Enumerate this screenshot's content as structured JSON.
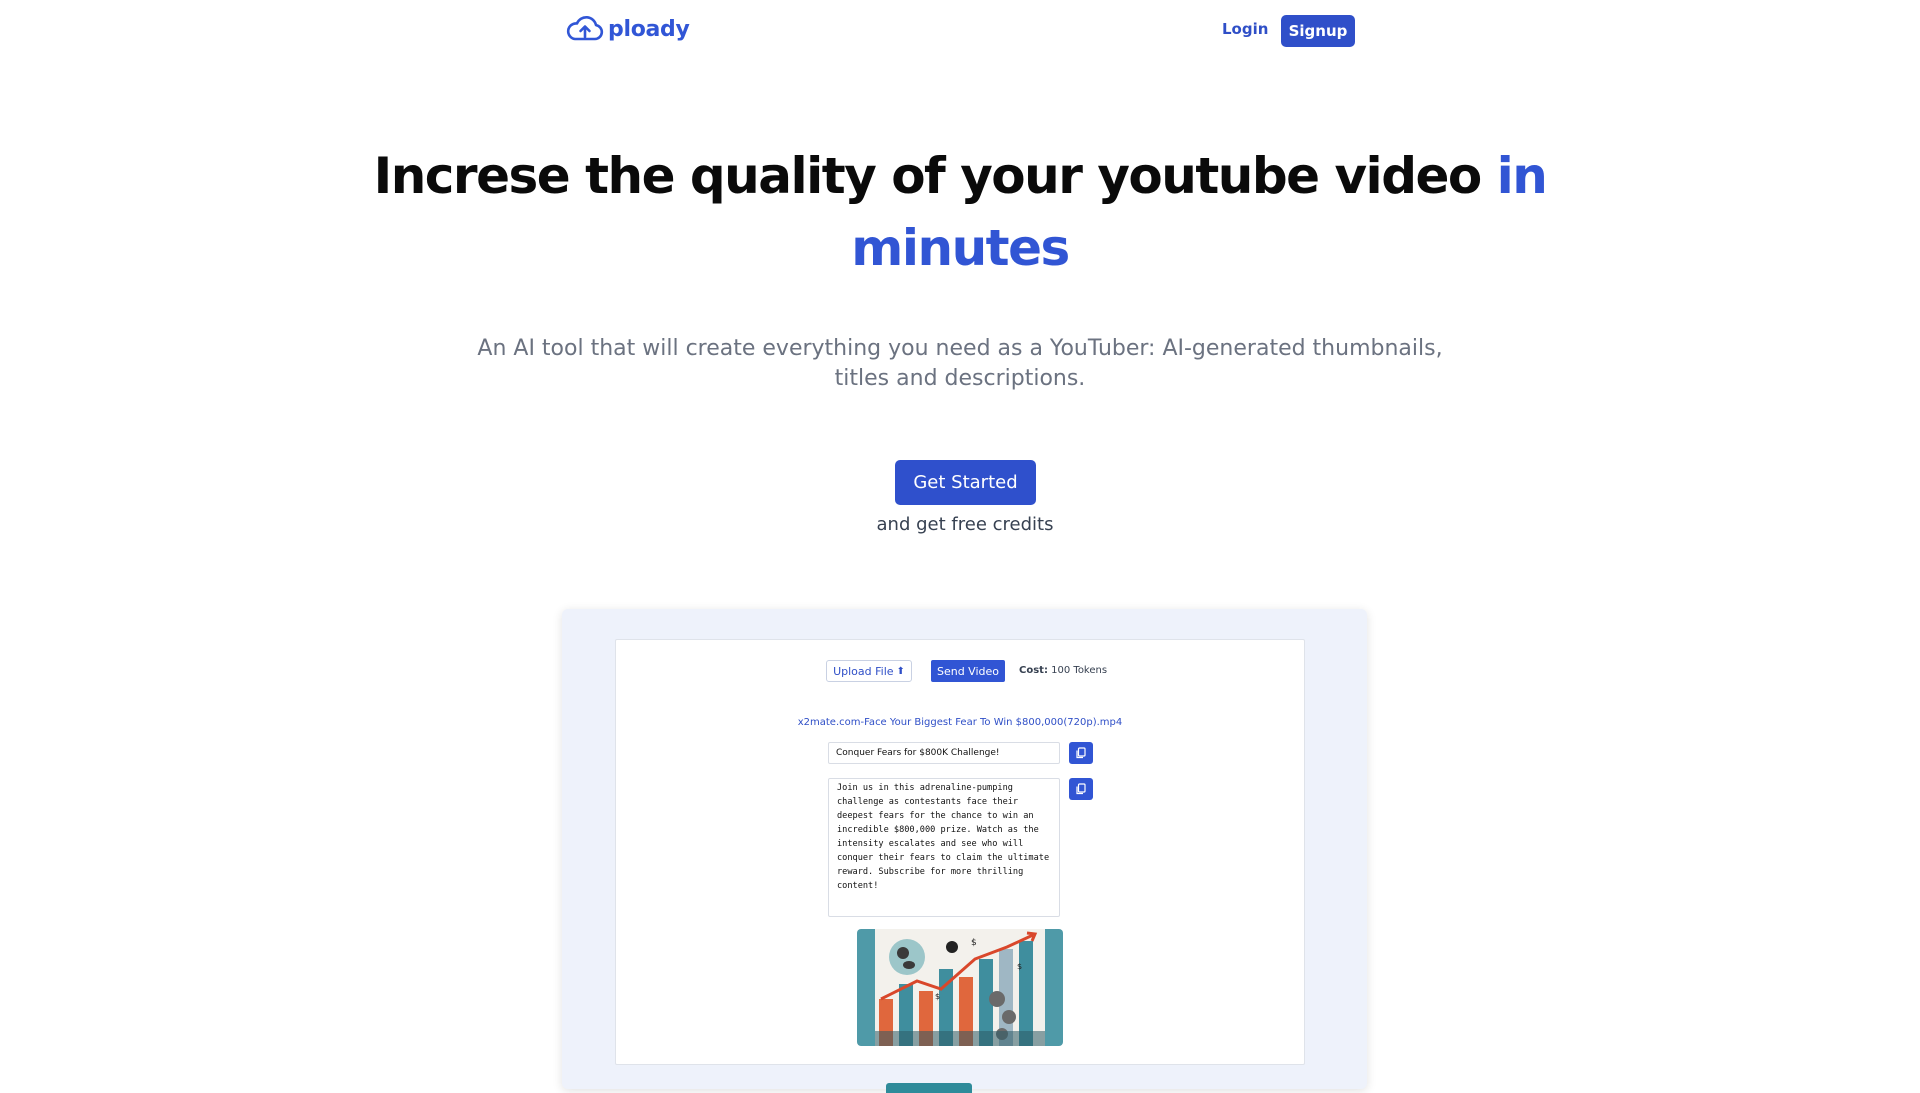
{
  "header": {
    "logo_text": "ploady",
    "login_label": "Login",
    "signup_label": "Signup"
  },
  "hero": {
    "title_main": "Increse the quality of your youtube video",
    "title_accent": "in minutes",
    "subtitle": "An AI tool that will create everything you need as a YouTuber: AI-generated thumbnails, titles and descriptions.",
    "cta_label": "Get Started",
    "cta_note": "and get free credits"
  },
  "preview": {
    "upload_label": "Upload File",
    "send_label": "Send Video",
    "cost_label": "Cost:",
    "cost_value": "100 Tokens",
    "file_name": "x2mate.com-Face Your Biggest Fear To Win $800,000(720p).mp4",
    "generated_title": "Conquer Fears for $800K Challenge!",
    "generated_description": "Join us in this adrenaline-pumping challenge as contestants face their deepest fears for the chance to win an incredible $800,000 prize. Watch as the intensity escalates and see who will conquer their fears to claim the ultimate reward. Subscribe for more thrilling content!"
  },
  "colors": {
    "brand": "#3155d4",
    "text_dark": "#0a0a0a",
    "text_muted": "#6b7280",
    "preview_bg": "#eef2fb"
  },
  "icons": {
    "logo": "cloud-upload-icon",
    "upload": "upload-arrow-icon",
    "copy": "copy-icon"
  }
}
